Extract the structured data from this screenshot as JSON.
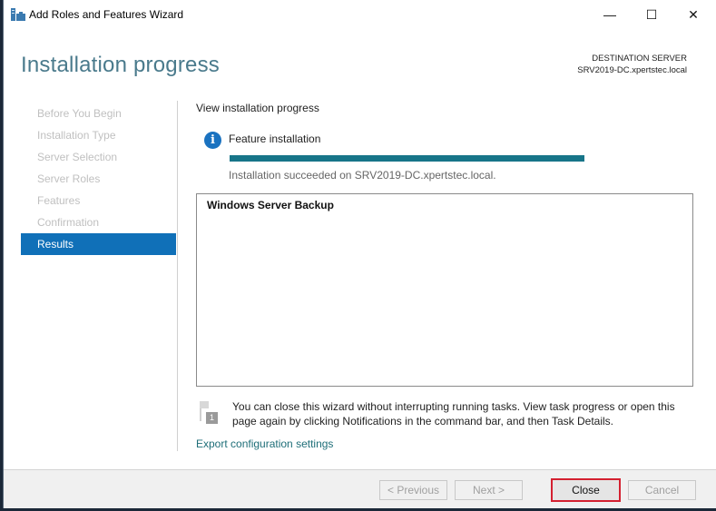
{
  "window": {
    "title": "Add Roles and Features Wizard",
    "controls": {
      "minimize": "—",
      "maximize": "☐",
      "close": "✕"
    }
  },
  "header": {
    "page_title": "Installation progress",
    "destination_label": "DESTINATION SERVER",
    "destination_server": "SRV2019-DC.xpertstec.local"
  },
  "nav": {
    "items": [
      {
        "label": "Before You Begin",
        "active": false
      },
      {
        "label": "Installation Type",
        "active": false
      },
      {
        "label": "Server Selection",
        "active": false
      },
      {
        "label": "Server Roles",
        "active": false
      },
      {
        "label": "Features",
        "active": false
      },
      {
        "label": "Confirmation",
        "active": false
      },
      {
        "label": "Results",
        "active": true
      }
    ]
  },
  "content": {
    "section_label": "View installation progress",
    "info_icon": "i",
    "feature_label": "Feature installation",
    "progress_percent": 100,
    "status_text": "Installation succeeded on SRV2019-DC.xpertstec.local.",
    "list_items": [
      "Windows Server Backup"
    ],
    "notice_badge": "1",
    "notice_text": "You can close this wizard without interrupting running tasks. View task progress or open this page again by clicking Notifications in the command bar, and then Task Details.",
    "export_link": "Export configuration settings"
  },
  "footer": {
    "previous_label": "< Previous",
    "next_label": "Next >",
    "close_label": "Close",
    "cancel_label": "Cancel"
  },
  "colors": {
    "accent": "#1070b8",
    "progress": "#177589",
    "highlight_border": "#d42030"
  }
}
